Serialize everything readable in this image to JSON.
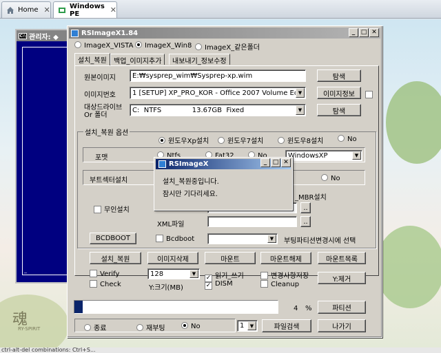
{
  "browser": {
    "tabs": [
      {
        "label": "Home",
        "active": false
      },
      {
        "label": "Windows PE",
        "active": true
      }
    ]
  },
  "cmd_window": {
    "title": "관리자: ◆",
    "cursor": "_"
  },
  "app": {
    "title": "RSImageX1.84",
    "os_radios": [
      {
        "label": "ImageX_VISTA",
        "selected": false
      },
      {
        "label": "ImageX_Win8",
        "selected": true
      },
      {
        "label": "ImageX_같은폴더",
        "selected": false
      }
    ],
    "tabs": [
      "설치_복원",
      "백업_이미지추가",
      "내보내기_정보수정"
    ],
    "source_label": "원본이미지",
    "source_value": "E:₩sysprep_wim₩Sysprep-xp.wim",
    "browse_label": "탐색",
    "index_label": "이미지번호",
    "index_value": "1 [SETUP] XP_PRO_KOR - Office 2007 Volume Editio",
    "image_info_label": "이미지정보",
    "target_label_1": "대상드라이브",
    "target_label_2": "Or 폴더",
    "target_value": "C:  NTFS              13.67GB  Fixed",
    "browse2_label": "탐색",
    "options_title": "설치_복원 옵션",
    "install_radios": [
      {
        "label": "윈도우Xp설치",
        "selected": true
      },
      {
        "label": "윈도우7설치",
        "selected": false
      },
      {
        "label": "윈도우8설치",
        "selected": false
      },
      {
        "label": "No",
        "selected": false
      }
    ],
    "format_label": "포맷",
    "format_radios": [
      {
        "label": "Ntfs",
        "selected": false
      },
      {
        "label": "Fat32",
        "selected": false
      },
      {
        "label": "No",
        "selected": false
      }
    ],
    "volume_label_value": "WindowsXP",
    "boot_sector_label": "부트섹터설치",
    "boot_no_label": "No",
    "mbr_label": "_MBR설치",
    "unattend_label": "무인설치",
    "xml_label": "XML파일",
    "browse_dots": "..",
    "bcdboot_button": "BCDBOOT",
    "bcdboot_check_label": "Bcdboot",
    "boot_partition_label": "부팅파티션변경시에 선택",
    "actions": [
      "설치_복원",
      "이미지삭제",
      "마운트",
      "마운트해제",
      "마운트목록"
    ],
    "verify_label": "Verify",
    "check_label": "Check",
    "size_value": "128",
    "size_label": "Y:크기(MB)",
    "rw_label": "읽기_쓰기",
    "dism_label": "DISM",
    "save_changes_label": "변경사항저장",
    "cleanup_label": "Cleanup",
    "y_remove_label": "Y:제거",
    "progress_percent": 4,
    "progress_text": "4",
    "percent_sign": "%",
    "partition_button": "파티션",
    "exit_radios": [
      {
        "label": "종료",
        "selected": false
      },
      {
        "label": "재부팅",
        "selected": false
      },
      {
        "label": "No",
        "selected": true
      }
    ],
    "page_value": "1",
    "file_search_button": "파일검색",
    "exit_button": "나가기"
  },
  "popup": {
    "title": "RSImageX",
    "line1": "설치_복원중입니다.",
    "line2": "잠시만 기다리세요."
  },
  "watermark": {
    "text1": "魂",
    "text2": "RY-SPIRIT"
  },
  "status_text": "ctrl-alt-del combinations: Ctrl+S..."
}
